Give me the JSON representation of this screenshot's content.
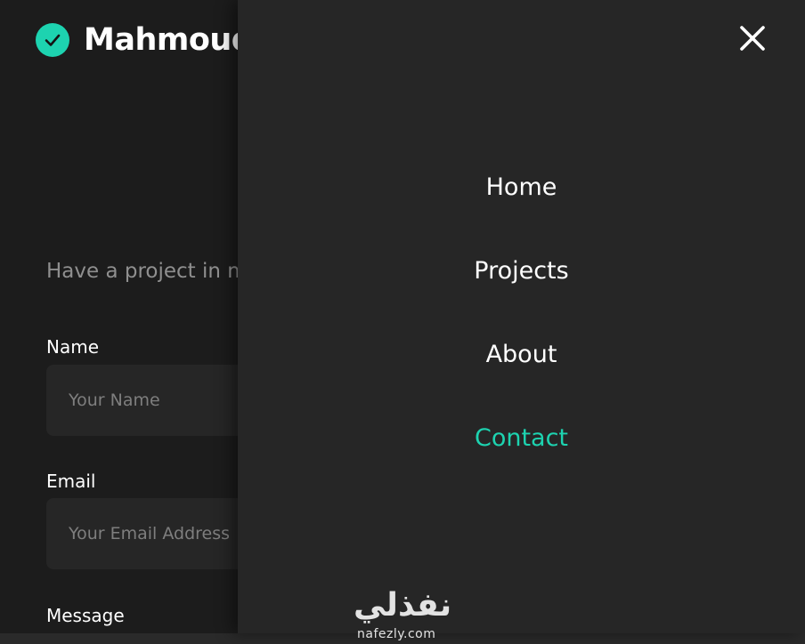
{
  "brand": {
    "name": "Mahmoud",
    "icon": "check-circle-icon",
    "accent": "#1dd3b0"
  },
  "contact": {
    "lead": "Have a project in mind?",
    "name_label": "Name",
    "name_placeholder": "Your Name",
    "email_label": "Email",
    "email_placeholder": "Your Email Address",
    "message_label": "Message"
  },
  "menu": {
    "close_icon": "close-icon",
    "items": [
      {
        "label": "Home",
        "active": false
      },
      {
        "label": "Projects",
        "active": false
      },
      {
        "label": "About",
        "active": false
      },
      {
        "label": "Contact",
        "active": true
      }
    ]
  },
  "watermark": {
    "text_arabic": "نفذلي",
    "text_latin": "nafezly.com"
  }
}
